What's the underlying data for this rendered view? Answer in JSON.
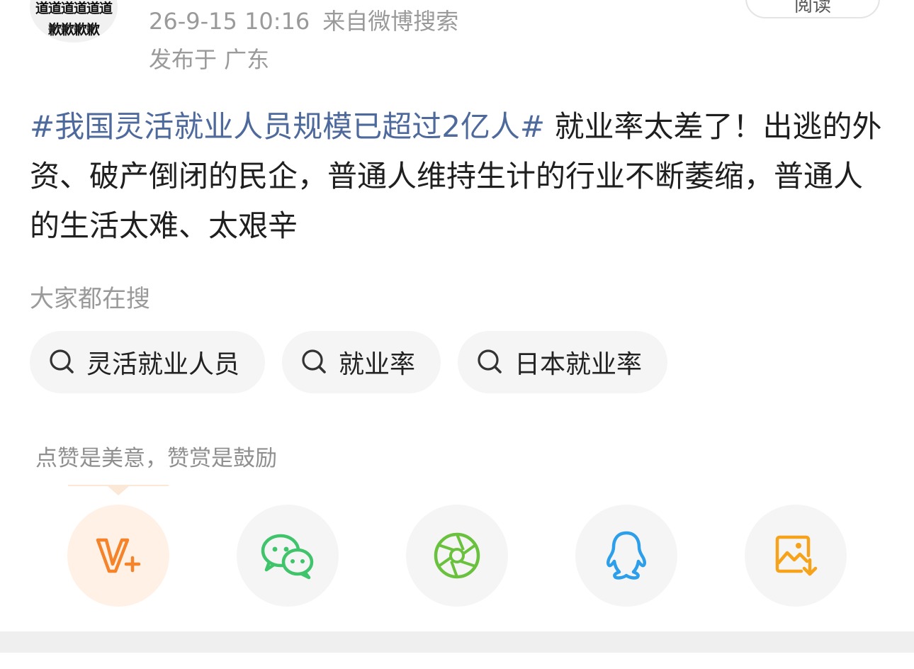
{
  "header": {
    "avatar_line1": "道道道道道道",
    "avatar_line2": "歉歉歉歉",
    "timestamp": "26-9-15 10:16",
    "source": "来自微博搜索",
    "location": "发布于 广东",
    "read_button_label": "阅读"
  },
  "post": {
    "hashtag": "#我国灵活就业人员规模已超过2亿人#",
    "text": " 就业率太差了！出逃的外资、破产倒闭的民企，普通人维持生计的行业不断萎缩，普通人的生活太难、太艰辛"
  },
  "search": {
    "title": "大家都在搜",
    "chips": [
      {
        "label": "灵活就业人员",
        "icon": "search-icon"
      },
      {
        "label": "就业率",
        "icon": "search-icon"
      },
      {
        "label": "日本就业率",
        "icon": "search-icon"
      }
    ]
  },
  "tip": {
    "text": "点赞是美意，赞赏是鼓励"
  },
  "share": [
    {
      "name": "vip-plus",
      "icon": "v-plus-icon",
      "color": "#f5832a"
    },
    {
      "name": "wechat",
      "icon": "wechat-icon",
      "color": "#3fc46b"
    },
    {
      "name": "moments",
      "icon": "moments-aperture-icon",
      "color": "#6ac13d"
    },
    {
      "name": "qq",
      "icon": "qq-penguin-icon",
      "color": "#2d9fea"
    },
    {
      "name": "save-image",
      "icon": "save-image-icon",
      "color": "#f6a21a"
    }
  ],
  "colors": {
    "hashtag": "#4e6a9c",
    "meta_text": "#9a9a9a",
    "chip_bg": "#f5f5f5"
  }
}
